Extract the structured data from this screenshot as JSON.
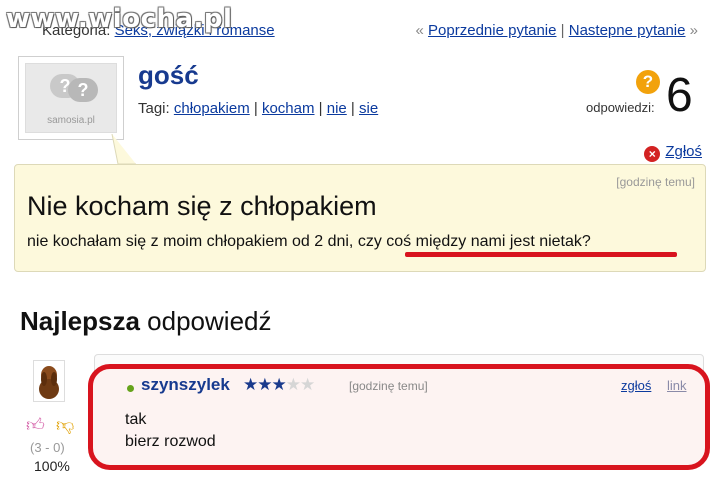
{
  "watermark": "www.wiocha.pl",
  "category": {
    "label": "Kategoria:",
    "value": "Seks, związki i romanse"
  },
  "nav": {
    "prev_prefix": "«",
    "prev": "Poprzednie pytanie",
    "separator": "|",
    "next": "Nastepne pytanie",
    "next_suffix": "»"
  },
  "question": {
    "avatar_caption": "samosia.pl",
    "author": "gość",
    "tags_label": "Tagi:",
    "tags": [
      "chłopakiem",
      "kocham",
      "nie",
      "sie"
    ],
    "answers_label": "odpowiedzi:",
    "answers_count": "6",
    "report": "Zgłoś",
    "time": "[godzinę temu]",
    "title": "Nie kocham się z chłopakiem",
    "body": "nie kochałam się z moim chłopakiem od 2 dni, czy coś między nami jest nietak?"
  },
  "best_answer": {
    "heading_bold": "Najlepsza",
    "heading_rest": " odpowiedź",
    "author": "szynszylek",
    "rating": 2.5,
    "rating_max": 5,
    "time": "[godzinę temu]",
    "report": "zgłoś",
    "link": "link",
    "line1": "tak",
    "line2": "bierz rozwod",
    "votes": "(3 - 0)",
    "percent": "100%"
  },
  "colors": {
    "link": "#0b3a9e",
    "highlight": "#d8141e",
    "question_bg": "#fdf9dc"
  }
}
